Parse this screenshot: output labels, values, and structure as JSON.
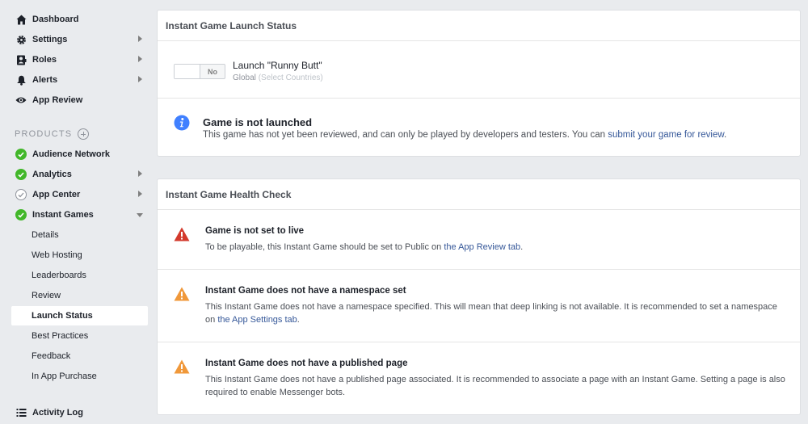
{
  "sidebar": {
    "top_items": [
      {
        "label": "Dashboard",
        "icon": "home-icon"
      },
      {
        "label": "Settings",
        "icon": "gear-icon"
      },
      {
        "label": "Roles",
        "icon": "roles-icon"
      },
      {
        "label": "Alerts",
        "icon": "bell-icon"
      },
      {
        "label": "App Review",
        "icon": "eye-icon"
      }
    ],
    "products_label": "PRODUCTS",
    "products": [
      {
        "label": "Audience Network",
        "status": "complete"
      },
      {
        "label": "Analytics",
        "status": "complete"
      },
      {
        "label": "App Center",
        "status": "incomplete"
      },
      {
        "label": "Instant Games",
        "status": "complete"
      }
    ],
    "instant_games_sub": [
      "Details",
      "Web Hosting",
      "Leaderboards",
      "Review",
      "Launch Status",
      "Best Practices",
      "Feedback",
      "In App Purchase"
    ],
    "active_sub": "Launch Status",
    "activity_log": "Activity Log"
  },
  "launch_status": {
    "title": "Instant Game Launch Status",
    "toggle_label": "No",
    "launch_name": "Launch \"Runny Butt\"",
    "scope": "Global",
    "scope_note": "(Select Countries)",
    "info_title": "Game is not launched",
    "info_text": "This game has not yet been reviewed, and can only be played by developers and testers. You can",
    "info_link": "submit your game for review",
    "info_end": "."
  },
  "health_check": {
    "title": "Instant Game Health Check",
    "items": [
      {
        "severity": "error",
        "title": "Game is not set to live",
        "text": "To be playable, this Instant Game should be set to Public on",
        "link": "the App Review tab",
        "end": "."
      },
      {
        "severity": "warning",
        "title": "Instant Game does not have a namespace set",
        "text": "This Instant Game does not have a namespace specified. This will mean that deep linking is not available. It is recommended to set a namespace on",
        "link": "the App Settings tab",
        "end": "."
      },
      {
        "severity": "warning",
        "title": "Instant Game does not have a published page",
        "text": "This Instant Game does not have a published page associated. It is recommended to associate a page with an Instant Game. Setting a page is also required to enable Messenger bots.",
        "link": "",
        "end": ""
      }
    ]
  },
  "colors": {
    "error": "#d33a2c",
    "warning": "#f0983a",
    "info": "#4080ff",
    "success": "#42b72a",
    "link": "#365899"
  }
}
